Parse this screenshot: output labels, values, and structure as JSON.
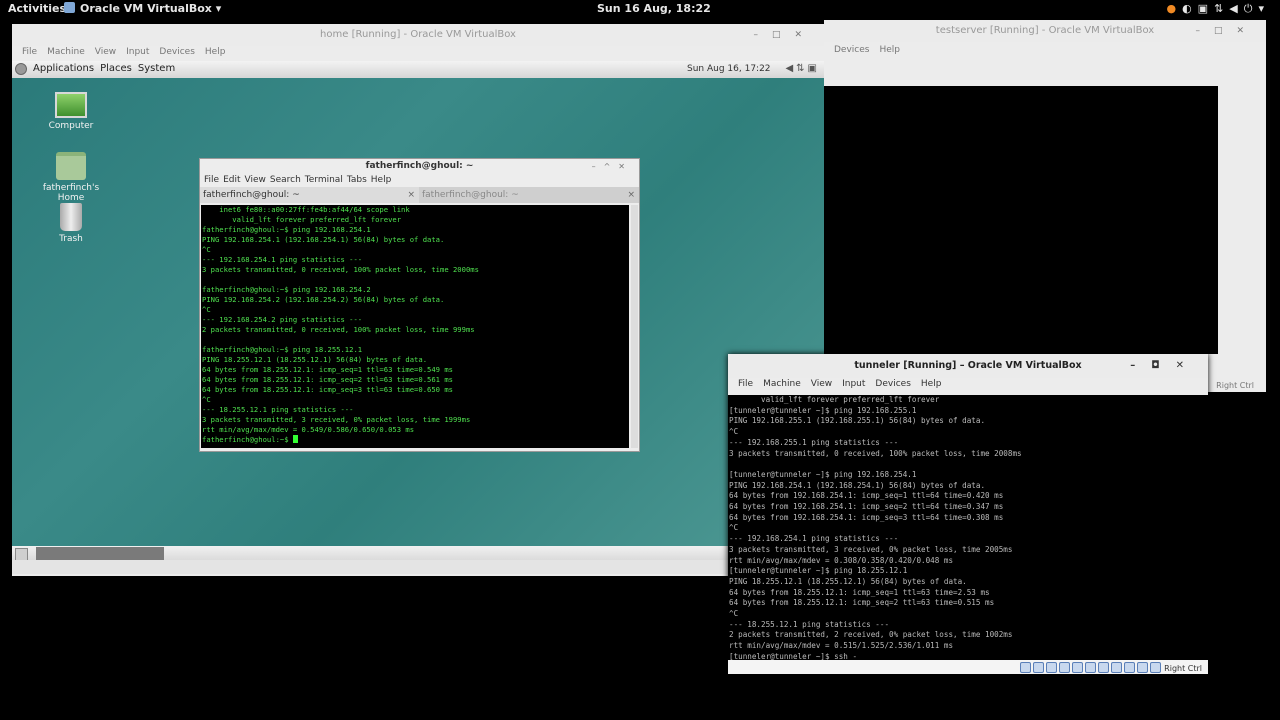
{
  "topbar": {
    "activities": "Activities",
    "app_menu": "Oracle VM VirtualBox",
    "clock": "Sun 16 Aug, 18:22"
  },
  "home_vm": {
    "title": "home [Running] - Oracle VM VirtualBox",
    "menu": [
      "File",
      "Machine",
      "View",
      "Input",
      "Devices",
      "Help"
    ],
    "guest_panel": {
      "menus": [
        "Applications",
        "Places",
        "System"
      ],
      "clock": "Sun Aug 16, 17:22"
    },
    "desktop_icons": [
      "Computer",
      "fatherfinch's Home",
      "Trash"
    ],
    "terminal": {
      "title": "fatherfinch@ghoul: ~",
      "menu": [
        "File",
        "Edit",
        "View",
        "Search",
        "Terminal",
        "Tabs",
        "Help"
      ],
      "tabs": [
        "fatherfinch@ghoul: ~",
        "fatherfinch@ghoul: ~"
      ],
      "lines": [
        "    inet6 fe80::a00:27ff:fe4b:af44/64 scope link",
        "       valid_lft forever preferred_lft forever",
        "fatherfinch@ghoul:~$ ping 192.168.254.1",
        "PING 192.168.254.1 (192.168.254.1) 56(84) bytes of data.",
        "^C",
        "--- 192.168.254.1 ping statistics ---",
        "3 packets transmitted, 0 received, 100% packet loss, time 2000ms",
        "",
        "fatherfinch@ghoul:~$ ping 192.168.254.2",
        "PING 192.168.254.2 (192.168.254.2) 56(84) bytes of data.",
        "^C",
        "--- 192.168.254.2 ping statistics ---",
        "2 packets transmitted, 0 received, 100% packet loss, time 999ms",
        "",
        "fatherfinch@ghoul:~$ ping 18.255.12.1",
        "PING 18.255.12.1 (18.255.12.1) 56(84) bytes of data.",
        "64 bytes from 18.255.12.1: icmp_seq=1 ttl=63 time=0.549 ms",
        "64 bytes from 18.255.12.1: icmp_seq=2 ttl=63 time=0.561 ms",
        "64 bytes from 18.255.12.1: icmp_seq=3 ttl=63 time=0.650 ms",
        "^C",
        "--- 18.255.12.1 ping statistics ---",
        "3 packets transmitted, 3 received, 0% packet loss, time 1999ms",
        "rtt min/avg/max/mdev = 0.549/0.586/0.650/0.053 ms"
      ],
      "prompt": "fatherfinch@ghoul:~$ "
    }
  },
  "testserver_vm": {
    "title": "testserver [Running] - Oracle VM VirtualBox",
    "menu": [
      "Devices",
      "Help"
    ],
    "right_ctrl": "Right Ctrl"
  },
  "tunneler_vm": {
    "title": "tunneler [Running] – Oracle VM VirtualBox",
    "menu": [
      "File",
      "Machine",
      "View",
      "Input",
      "Devices",
      "Help"
    ],
    "lines": [
      "       valid_lft forever preferred_lft forever",
      "[tunneler@tunneler ~]$ ping 192.168.255.1",
      "PING 192.168.255.1 (192.168.255.1) 56(84) bytes of data.",
      "^C",
      "--- 192.168.255.1 ping statistics ---",
      "3 packets transmitted, 0 received, 100% packet loss, time 2008ms",
      "",
      "[tunneler@tunneler ~]$ ping 192.168.254.1",
      "PING 192.168.254.1 (192.168.254.1) 56(84) bytes of data.",
      "64 bytes from 192.168.254.1: icmp_seq=1 ttl=64 time=0.420 ms",
      "64 bytes from 192.168.254.1: icmp_seq=2 ttl=64 time=0.347 ms",
      "64 bytes from 192.168.254.1: icmp_seq=3 ttl=64 time=0.308 ms",
      "^C",
      "--- 192.168.254.1 ping statistics ---",
      "3 packets transmitted, 3 received, 0% packet loss, time 2005ms",
      "rtt min/avg/max/mdev = 0.308/0.358/0.420/0.048 ms",
      "[tunneler@tunneler ~]$ ping 18.255.12.1",
      "PING 18.255.12.1 (18.255.12.1) 56(84) bytes of data.",
      "64 bytes from 18.255.12.1: icmp_seq=1 ttl=63 time=2.53 ms",
      "64 bytes from 18.255.12.1: icmp_seq=2 ttl=63 time=0.515 ms",
      "^C",
      "--- 18.255.12.1 ping statistics ---",
      "2 packets transmitted, 2 received, 0% packet loss, time 1002ms",
      "rtt min/avg/max/mdev = 0.515/1.525/2.536/1.011 ms",
      "[tunneler@tunneler ~]$ ssh -"
    ],
    "right_ctrl": "Right Ctrl"
  }
}
